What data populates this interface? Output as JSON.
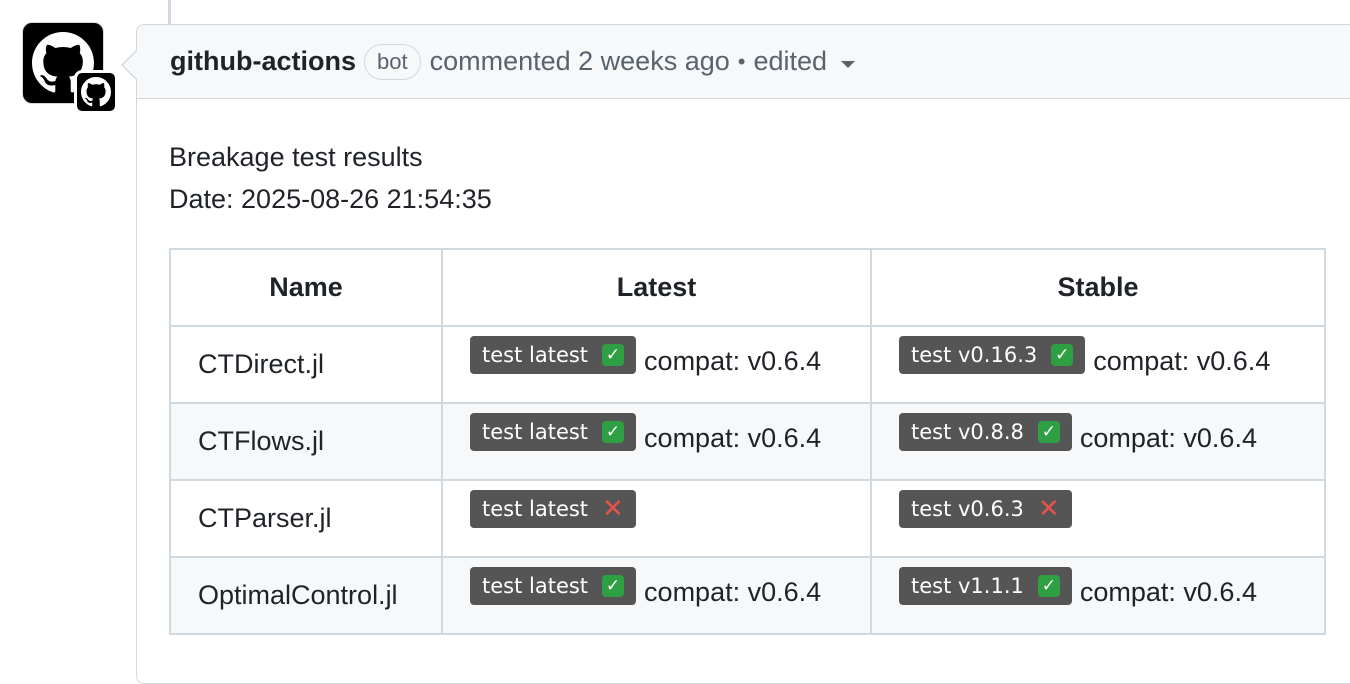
{
  "comment": {
    "author": "github-actions",
    "bot_label": "bot",
    "action": "commented 2 weeks ago",
    "separator": "•",
    "edited_label": "edited",
    "body_title": "Breakage test results",
    "body_date": "Date: 2025-08-26 21:54:35"
  },
  "table": {
    "headers": [
      "Name",
      "Latest",
      "Stable"
    ],
    "rows": [
      {
        "name": "CTDirect.jl",
        "latest": {
          "badge": "test latest",
          "status": "pass",
          "compat": "compat: v0.6.4"
        },
        "stable": {
          "badge": "test v0.16.3",
          "status": "pass",
          "compat": "compat: v0.6.4"
        }
      },
      {
        "name": "CTFlows.jl",
        "latest": {
          "badge": "test latest",
          "status": "pass",
          "compat": "compat: v0.6.4"
        },
        "stable": {
          "badge": "test v0.8.8",
          "status": "pass",
          "compat": "compat: v0.6.4"
        }
      },
      {
        "name": "CTParser.jl",
        "latest": {
          "badge": "test latest",
          "status": "fail",
          "compat": ""
        },
        "stable": {
          "badge": "test v0.6.3",
          "status": "fail",
          "compat": ""
        }
      },
      {
        "name": "OptimalControl.jl",
        "latest": {
          "badge": "test latest",
          "status": "pass",
          "compat": "compat: v0.6.4"
        },
        "stable": {
          "badge": "test v1.1.1",
          "status": "pass",
          "compat": "compat: v0.6.4"
        }
      }
    ]
  },
  "icons": {
    "avatar": "github-octocat-icon",
    "avatar_badge": "github-app-badge-icon",
    "edited_menu": "caret-down-icon",
    "pass": "check-mark-icon",
    "fail": "cross-mark-icon"
  },
  "colors": {
    "badge_bg": "#555555",
    "pass": "#2ea043",
    "fail": "#e5534b",
    "header_bg": "#f6f8fa",
    "border": "#d1d9e0"
  }
}
